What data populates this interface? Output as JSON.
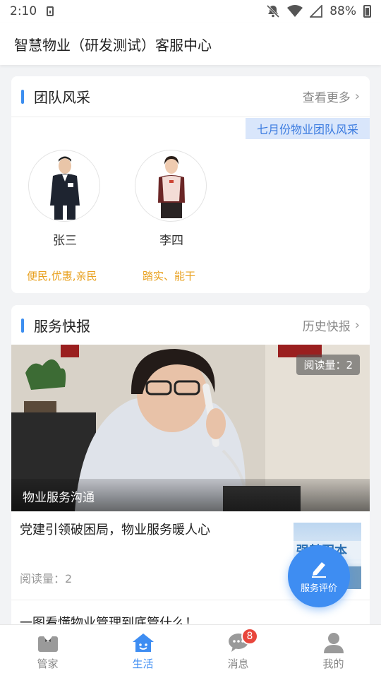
{
  "status_bar": {
    "time": "2:10",
    "battery": "88%"
  },
  "app_bar": {
    "title": "智慧物业（研发测试）客服中心"
  },
  "team_section": {
    "title": "团队风采",
    "more_label": "查看更多",
    "banner": "七月份物业团队风采",
    "members": [
      {
        "name": "张三",
        "tag": "便民,优惠,亲民"
      },
      {
        "name": "李四",
        "tag": "踏实、能干"
      }
    ]
  },
  "news_section": {
    "title": "服务快报",
    "more_label": "历史快报",
    "featured": {
      "read_count": "阅读量：2",
      "caption": "物业服务沟通"
    },
    "articles": [
      {
        "title": "党建引领破困局，物业服务暖人心",
        "read_count": "阅读量：2"
      },
      {
        "title": "一图看懂物业管理到底管什么！"
      }
    ]
  },
  "fab": {
    "label": "服务评价"
  },
  "tab_bar": {
    "active": "生活",
    "tabs": [
      {
        "label": "管家",
        "icon": "butler-icon"
      },
      {
        "label": "生活",
        "icon": "home-icon"
      },
      {
        "label": "消息",
        "icon": "message-icon",
        "badge": "8"
      },
      {
        "label": "我的",
        "icon": "person-icon"
      }
    ]
  },
  "colors": {
    "accent": "#3e8df2",
    "tag_orange": "#e8a01e",
    "badge_red": "#e8463c"
  }
}
